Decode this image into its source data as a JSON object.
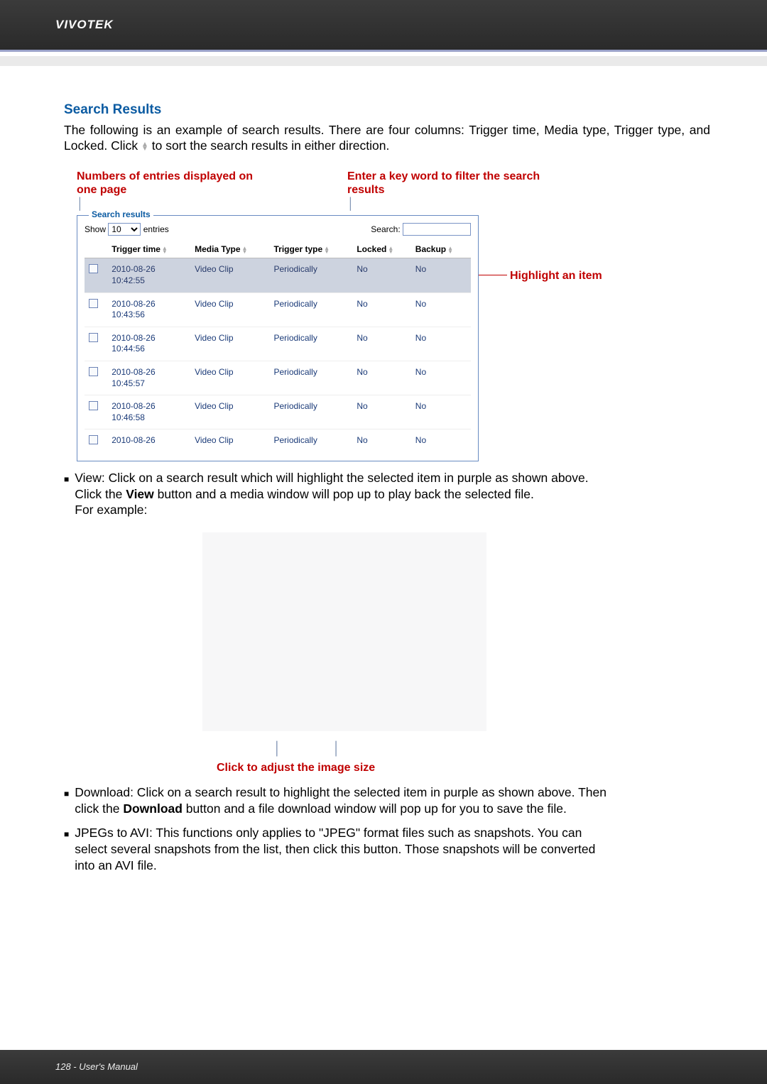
{
  "brand": "VIVOTEK",
  "section_title": "Search Results",
  "intro_line1": "The following is an example of search results. There are four columns: Trigger time, Media type,",
  "intro_line2": "Trigger type, and Locked. Click",
  "intro_line3": "to sort the search results in either direction.",
  "callout_left": "Numbers of entries displayed on one page",
  "callout_right": "Enter a key word to filter the search results",
  "panel": {
    "legend": "Search results",
    "show_label_pre": "Show",
    "show_value": "10",
    "show_label_post": "entries",
    "search_label": "Search:",
    "headers": {
      "trigger_time": "Trigger time",
      "media_type": "Media Type",
      "trigger_type": "Trigger type",
      "locked": "Locked",
      "backup": "Backup"
    },
    "rows": [
      {
        "trigger_time": "2010-08-26 10:42:55",
        "media": "Video Clip",
        "type": "Periodically",
        "locked": "No",
        "backup": "No",
        "highlight": true
      },
      {
        "trigger_time": "2010-08-26 10:43:56",
        "media": "Video Clip",
        "type": "Periodically",
        "locked": "No",
        "backup": "No"
      },
      {
        "trigger_time": "2010-08-26 10:44:56",
        "media": "Video Clip",
        "type": "Periodically",
        "locked": "No",
        "backup": "No"
      },
      {
        "trigger_time": "2010-08-26 10:45:57",
        "media": "Video Clip",
        "type": "Periodically",
        "locked": "No",
        "backup": "No"
      },
      {
        "trigger_time": "2010-08-26 10:46:58",
        "media": "Video Clip",
        "type": "Periodically",
        "locked": "No",
        "backup": "No"
      },
      {
        "trigger_time": "2010-08-26",
        "media": "Video Clip",
        "type": "Periodically",
        "locked": "No",
        "backup": "No"
      }
    ]
  },
  "highlight_label": "Highlight an item",
  "bullets": {
    "view_l1": "View: Click on a search result which will highlight the selected item in purple as shown above.",
    "view_l2": "Click the ",
    "view_bold": "View",
    "view_l3": " button and a media window will pop up to play back the selected file.",
    "view_l4": "For example:",
    "adjust": "Click to adjust the image size",
    "dl_l1": "Download: Click on a search result to highlight the selected item in purple as shown above. Then",
    "dl_l2": "click the ",
    "dl_bold": "Download",
    "dl_l3": " button and a file download window will pop up for you to save the file.",
    "jp_l1": "JPEGs to AVI: This functions only applies to \"JPEG\" format files such as snapshots. You can",
    "jp_l2": "select several snapshots from the list, then click this button. Those snapshots will be converted",
    "jp_l3": "into an AVI file."
  },
  "footer": "128 - User's Manual"
}
